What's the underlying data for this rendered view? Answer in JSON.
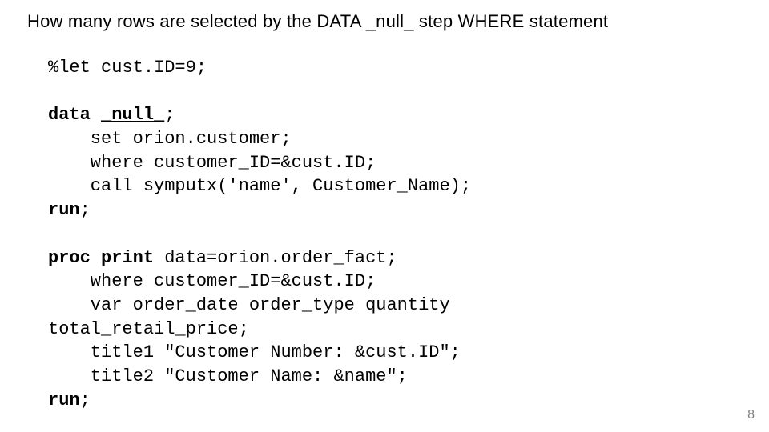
{
  "title": "How many rows are selected by the DATA _null_ step WHERE statement",
  "code": {
    "line1": "%let cust.ID=9;",
    "line2_a": "data",
    "line2_b": "_null_",
    "line2_c": ";",
    "line3": "    set orion.customer;",
    "line4": "    where customer_ID=&cust.ID;",
    "line5": "    call symputx('name', Customer_Name);",
    "line6_a": "run",
    "line6_b": ";",
    "line7_a": "proc print",
    "line7_b": " data",
    "line7_c": "=orion.order_fact;",
    "line8": "    where customer_ID=&cust.ID;",
    "line9": "    var order_date order_type quantity",
    "line10": "total_retail_price;",
    "line11": "    title1 \"Customer Number: &cust.ID\";",
    "line12": "    title2 \"Customer Name: &name\";",
    "line13_a": "run",
    "line13_b": ";"
  },
  "pagenum": "8"
}
